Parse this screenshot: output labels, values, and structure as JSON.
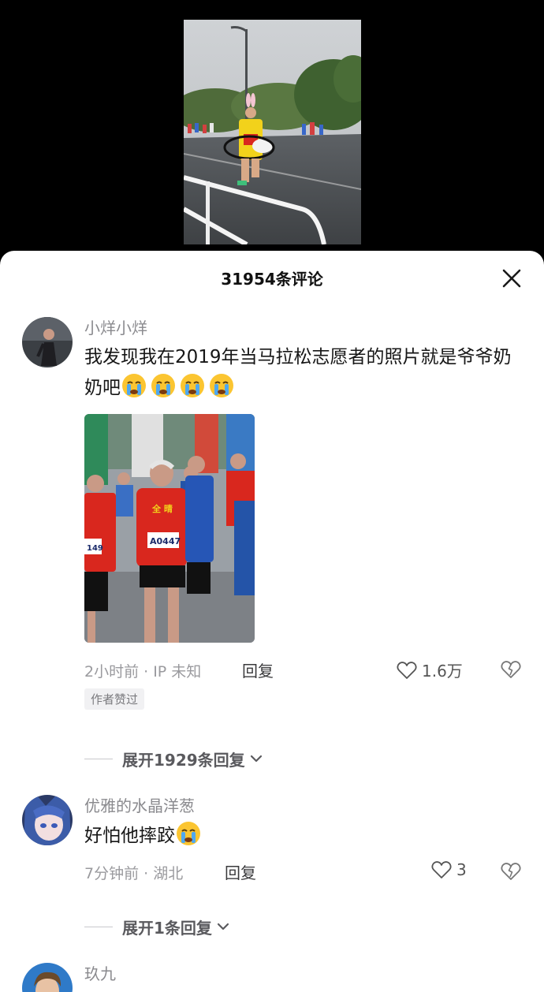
{
  "header": {
    "title": "31954条评论",
    "close_icon": "close-icon"
  },
  "comments": [
    {
      "username": "小烊小烊",
      "text": "我发现我在2019年当马拉松志愿者的照片就是爷爷奶奶吧",
      "emoji": [
        "crying-emoji",
        "crying-emoji",
        "crying-emoji",
        "crying-emoji"
      ],
      "time": "2小时前 · IP 未知",
      "reply_label": "回复",
      "likes": "1.6万",
      "badge": "作者赞过",
      "expand_label": "展开1929条回复",
      "image_bib_a": "A0447",
      "image_bib_b": "149"
    },
    {
      "username": "优雅的水晶洋葱",
      "text": "好怕他摔跤",
      "emoji": [
        "crying-emoji"
      ],
      "time": "7分钟前 · 湖北",
      "reply_label": "回复",
      "likes": "3",
      "expand_label": "展开1条回复"
    },
    {
      "username": "玖九"
    }
  ],
  "colors": {
    "sheet_bg": "#ffffff",
    "muted_text": "#8a8a8e",
    "shirt_red": "#d9271e",
    "shirt_yellow": "#f2d21b"
  }
}
